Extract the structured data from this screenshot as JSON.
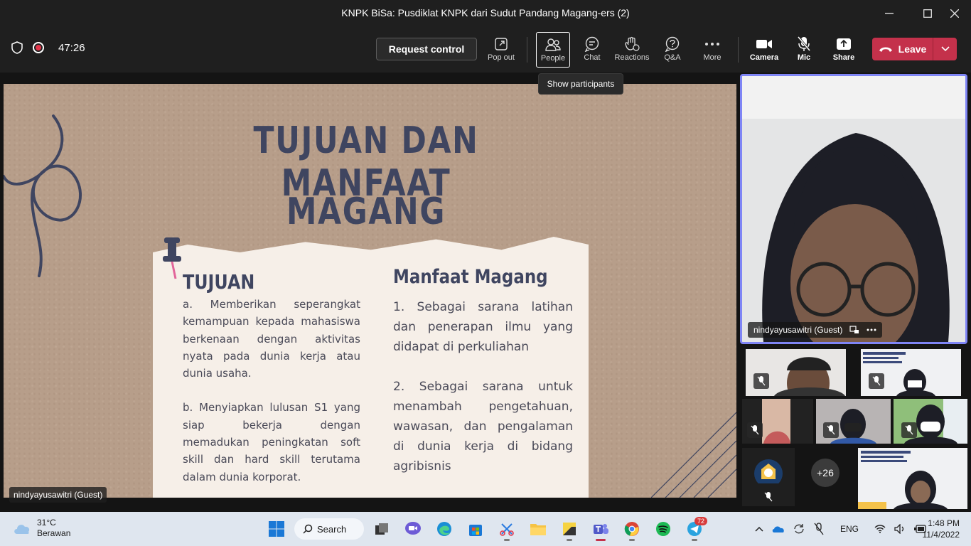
{
  "window": {
    "title": "KNPK BiSa: Pusdiklat KNPK dari Sudut Pandang Magang-ers (2)"
  },
  "toolbar": {
    "timer": "47:26",
    "request_control": "Request control",
    "buttons": [
      {
        "label": "Pop out",
        "icon": "pop-out-icon"
      },
      {
        "label": "People",
        "icon": "people-icon"
      },
      {
        "label": "Chat",
        "icon": "chat-icon"
      },
      {
        "label": "Reactions",
        "icon": "reactions-icon"
      },
      {
        "label": "Q&A",
        "icon": "qa-icon"
      },
      {
        "label": "More",
        "icon": "more-icon"
      },
      {
        "label": "Camera",
        "icon": "camera-icon"
      },
      {
        "label": "Mic",
        "icon": "mic-off-icon"
      },
      {
        "label": "Share",
        "icon": "share-icon"
      }
    ],
    "leave": "Leave",
    "tooltip": "Show participants"
  },
  "slide": {
    "title_line1": "TUJUAN DAN MANFAAT",
    "title_line2": "MAGANG",
    "left_heading": "TUJUAN",
    "left_items": [
      "a. Memberikan seperangkat kemampuan kepada mahasiswa berkenaan dengan aktivitas nyata pada dunia kerja atau dunia usaha.",
      "b. Menyiapkan lulusan S1 yang siap bekerja dengan memadukan peningkatan soft skill dan hard skill terutama dalam dunia korporat."
    ],
    "right_heading": "Manfaat Magang",
    "right_items": [
      "1. Sebagai sarana latihan dan penerapan ilmu yang didapat di perkuliahan",
      "2. Sebagai sarana untuk menambah pengetahuan, wawasan, dan pengalaman di dunia kerja di bidang agribisnis"
    ],
    "presenter_label": "nindyayusawitri (Guest)"
  },
  "participants": {
    "main_name": "nindyayusawitri (Guest)",
    "overflow_count": "+26"
  },
  "taskbar": {
    "weather_temp": "31°C",
    "weather_desc": "Berawan",
    "search_label": "Search",
    "telegram_badge": "72",
    "language": "ENG",
    "time": "1:48 PM",
    "date": "11/4/2022"
  }
}
